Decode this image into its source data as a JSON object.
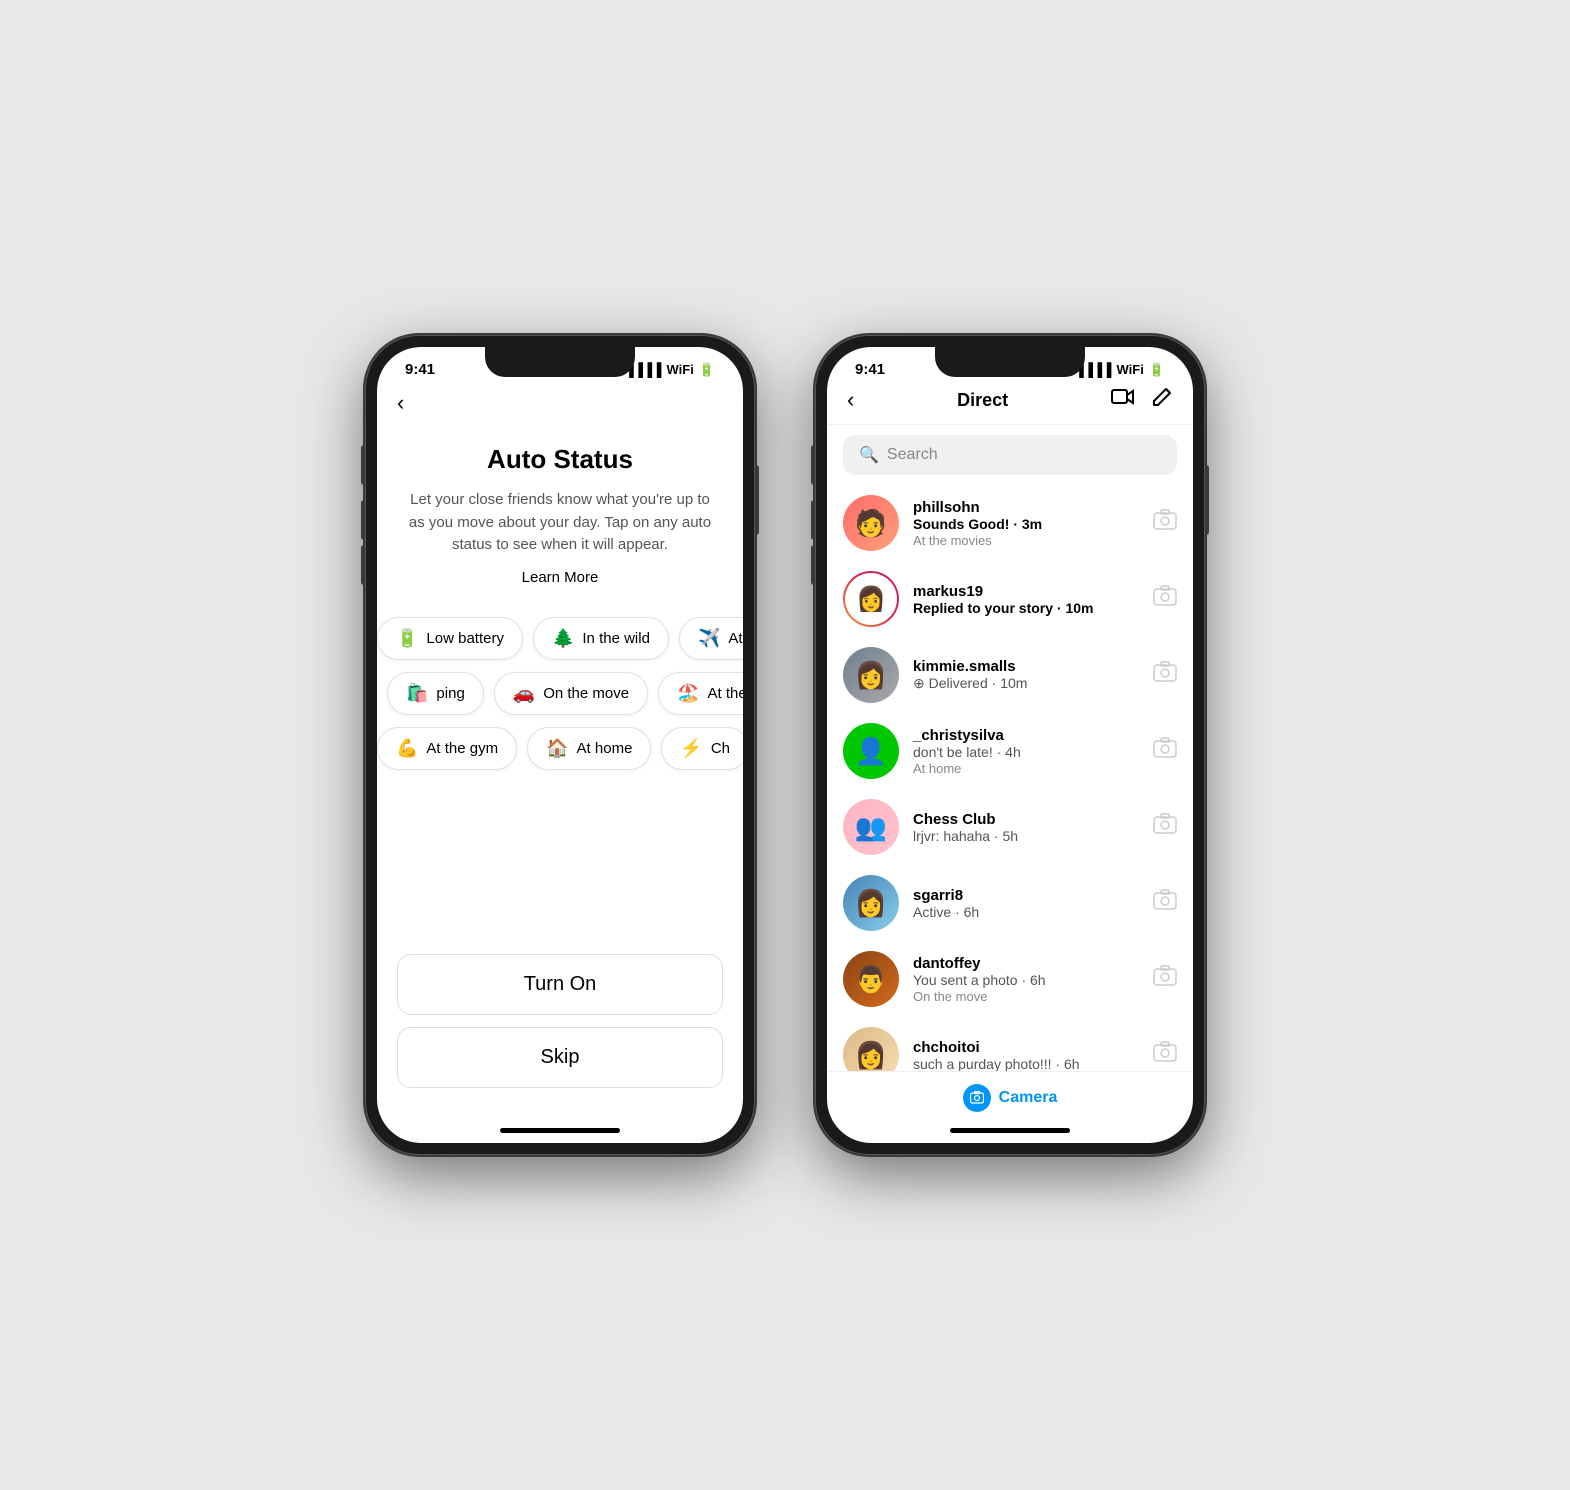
{
  "phone1": {
    "status_time": "9:41",
    "title": "Auto Status",
    "description": "Let your close friends know what you're up to as you move about your day. Tap on any auto status to see when it will appear.",
    "learn_more": "Learn More",
    "chips": [
      [
        {
          "emoji": "🔋",
          "label": "Low battery"
        },
        {
          "emoji": "🌲",
          "label": "In the wild"
        },
        {
          "emoji": "✈️",
          "label": "At t"
        }
      ],
      [
        {
          "emoji": "🛍️",
          "label": "ping"
        },
        {
          "emoji": "🚗",
          "label": "On the move"
        },
        {
          "emoji": "🏖️",
          "label": "At the beac"
        }
      ],
      [
        {
          "emoji": "💪",
          "label": "At the gym"
        },
        {
          "emoji": "🏠",
          "label": "At home"
        },
        {
          "emoji": "⚡",
          "label": "Ch"
        }
      ]
    ],
    "btn_turn_on": "Turn On",
    "btn_skip": "Skip"
  },
  "phone2": {
    "status_time": "9:41",
    "header": {
      "title": "Direct",
      "back_label": "‹",
      "video_icon": "□",
      "edit_icon": "✏"
    },
    "search": {
      "placeholder": "Search"
    },
    "messages": [
      {
        "username": "phillsohn",
        "message": "Sounds Good! · 3m",
        "message_bold": true,
        "status": "At the movies",
        "avatar_class": "av-phillsohn",
        "avatar_emoji": "👦"
      },
      {
        "username": "markus19",
        "message": "Replied to your story · 10m",
        "message_bold": true,
        "status": "",
        "avatar_class": "av-markus19",
        "avatar_emoji": "👩"
      },
      {
        "username": "kimmie.smalls",
        "message": "⊕ Delivered · 10m",
        "message_bold": false,
        "status": "",
        "avatar_class": "av-kimmie",
        "avatar_emoji": "👩"
      },
      {
        "username": "_christysilva",
        "message": "don't be late! · 4h",
        "message_bold": false,
        "status": "At home",
        "avatar_class": "av-christy",
        "avatar_emoji": "👤"
      },
      {
        "username": "Chess Club",
        "message": "lrjvr: hahaha · 5h",
        "message_bold": false,
        "status": "",
        "avatar_class": "av-chess",
        "avatar_emoji": "👥"
      },
      {
        "username": "sgarri8",
        "message": "Active · 6h",
        "message_bold": false,
        "status": "",
        "avatar_class": "av-sgarri",
        "avatar_emoji": "👩"
      },
      {
        "username": "dantoffey",
        "message": "You sent a photo · 6h",
        "message_bold": false,
        "status": "On the move",
        "avatar_class": "av-dantoffey",
        "avatar_emoji": "👨"
      },
      {
        "username": "chchoitoi",
        "message": "such a purday photo!!! · 6h",
        "message_bold": false,
        "status": "",
        "avatar_class": "av-chchoitoi",
        "avatar_emoji": "👩"
      }
    ],
    "camera_label": "Camera"
  }
}
